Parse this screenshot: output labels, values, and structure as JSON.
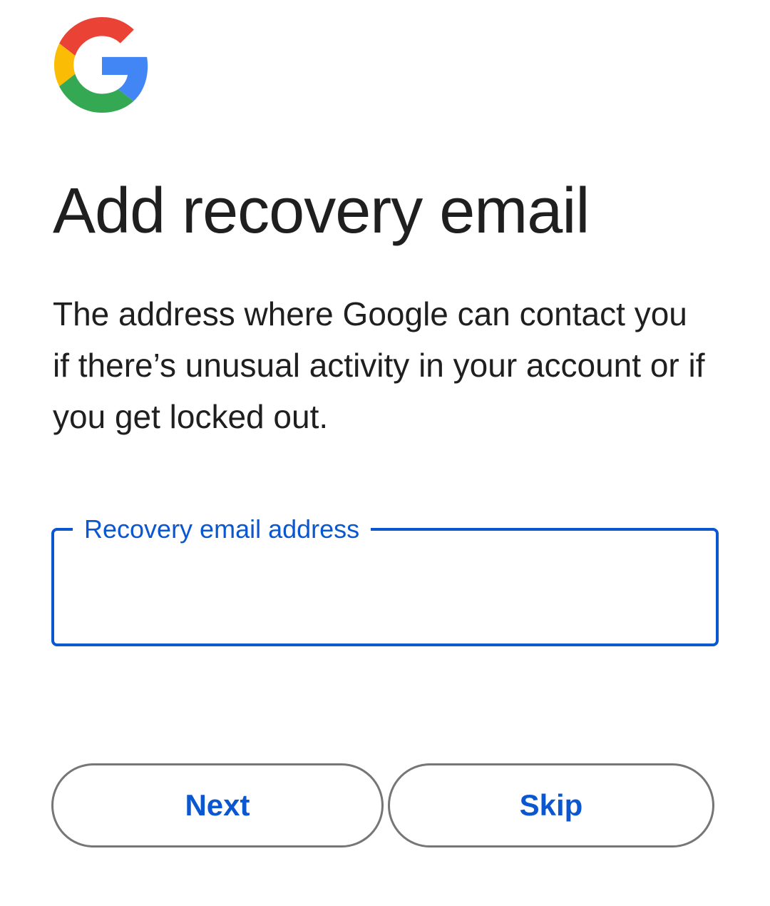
{
  "logo": {
    "icon": "google-g-logo-icon",
    "colors": {
      "red": "#EA4335",
      "yellow": "#FBBC05",
      "green": "#34A853",
      "blue": "#4285F4"
    }
  },
  "page": {
    "title": "Add recovery email",
    "description": "The address where Google can contact you if there’s unusual activity in your account or if you get locked out."
  },
  "form": {
    "email_label": "Recovery email address",
    "email_value": "",
    "accent_color": "#0b57d0"
  },
  "actions": {
    "next_label": "Next",
    "skip_label": "Skip"
  }
}
